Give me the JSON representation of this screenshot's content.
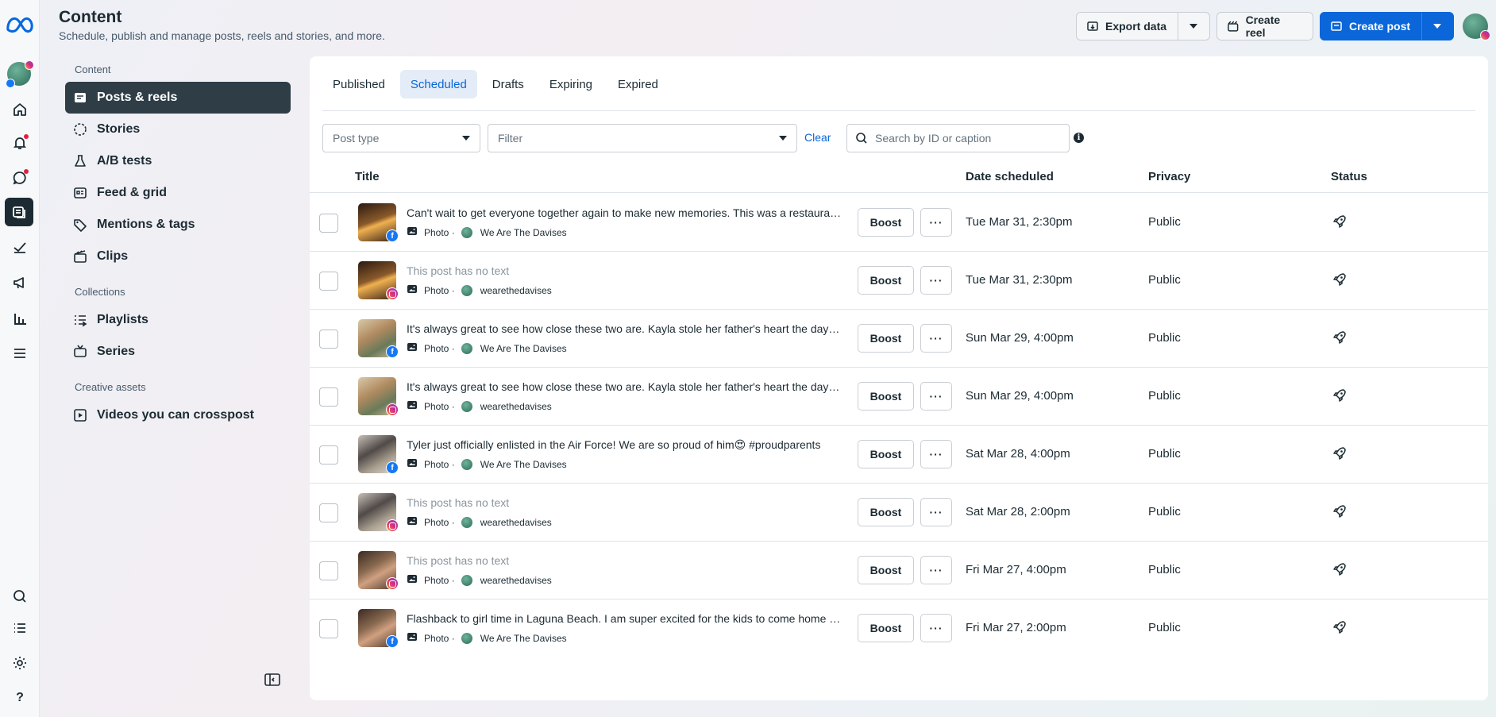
{
  "header": {
    "title": "Content",
    "subtitle": "Schedule, publish and manage posts, reels and stories, and more.",
    "export_label": "Export data",
    "create_reel_label": "Create reel",
    "create_post_label": "Create post"
  },
  "nav": {
    "section_content": "Content",
    "section_collections": "Collections",
    "section_creative": "Creative assets",
    "posts_reels": "Posts & reels",
    "stories": "Stories",
    "ab_tests": "A/B tests",
    "feed_grid": "Feed & grid",
    "mentions_tags": "Mentions & tags",
    "clips": "Clips",
    "playlists": "Playlists",
    "series": "Series",
    "videos_crosspost": "Videos you can crosspost"
  },
  "tabs": {
    "published": "Published",
    "scheduled": "Scheduled",
    "drafts": "Drafts",
    "expiring": "Expiring",
    "expired": "Expired"
  },
  "filters": {
    "post_type": "Post type",
    "filter": "Filter",
    "clear": "Clear",
    "search_placeholder": "Search by ID or caption",
    "info": "i"
  },
  "table": {
    "col_title": "Title",
    "col_date": "Date scheduled",
    "col_privacy": "Privacy",
    "col_status": "Status",
    "boost_label": "Boost",
    "more_label": "···",
    "rows": [
      {
        "caption": "Can't wait to get everyone together again to make new memories. This was a restaurant we went to last fall and the food was incredible",
        "type": "Photo ·",
        "page": "We Are The Davises",
        "platform": "facebook",
        "date": "Tue Mar 31, 2:30pm",
        "privacy": "Public",
        "status_icon": "rocket-icon"
      },
      {
        "caption": "This post has no text",
        "type": "Photo ·",
        "page": "wearethedavises",
        "platform": "instagram",
        "date": "Tue Mar 31, 2:30pm",
        "privacy": "Public",
        "status_icon": "rocket-icon"
      },
      {
        "caption": "It's always great to see how close these two are. Kayla stole her father's heart the day she was born",
        "type": "Photo ·",
        "page": "We Are The Davises",
        "platform": "facebook",
        "date": "Sun Mar 29, 4:00pm",
        "privacy": "Public",
        "status_icon": "rocket-icon"
      },
      {
        "caption": "It's always great to see how close these two are. Kayla stole her father's heart the day she was born",
        "type": "Photo ·",
        "page": "wearethedavises",
        "platform": "instagram",
        "date": "Sun Mar 29, 4:00pm",
        "privacy": "Public",
        "status_icon": "rocket-icon"
      },
      {
        "caption": "Tyler just officially enlisted in the Air Force! We are so proud of him😍 #proudparents",
        "type": "Photo ·",
        "page": "We Are The Davises",
        "platform": "facebook",
        "date": "Sat Mar 28, 4:00pm",
        "privacy": "Public",
        "status_icon": "rocket-icon"
      },
      {
        "caption": "This post has no text",
        "type": "Photo ·",
        "page": "wearethedavises",
        "platform": "instagram",
        "date": "Sat Mar 28, 2:00pm",
        "privacy": "Public",
        "status_icon": "rocket-icon"
      },
      {
        "caption": "This post has no text",
        "type": "Photo ·",
        "page": "wearethedavises",
        "platform": "instagram",
        "date": "Fri Mar 27, 4:00pm",
        "privacy": "Public",
        "status_icon": "rocket-icon"
      },
      {
        "caption": "Flashback to girl time in Laguna Beach. I am super excited for the kids to come home for the summer",
        "type": "Photo ·",
        "page": "We Are The Davises",
        "platform": "facebook",
        "date": "Fri Mar 27, 2:00pm",
        "privacy": "Public",
        "status_icon": "rocket-icon"
      }
    ]
  },
  "rail": {
    "help": "?"
  }
}
